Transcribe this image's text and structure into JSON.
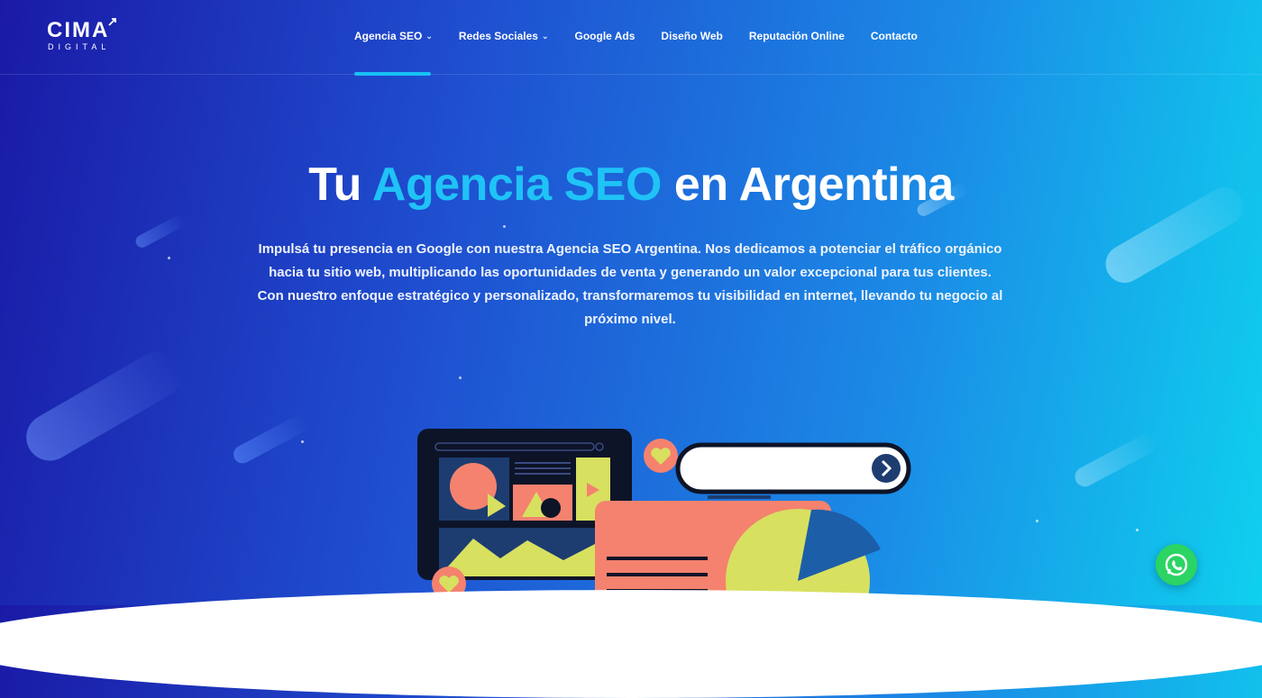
{
  "brand": {
    "logo_text": "CIMA",
    "logo_subtext": "DIGITAL"
  },
  "nav": {
    "items": [
      {
        "label": "Agencia SEO",
        "has_dropdown": true,
        "active": true
      },
      {
        "label": "Redes Sociales",
        "has_dropdown": true,
        "active": false
      },
      {
        "label": "Google Ads",
        "has_dropdown": false,
        "active": false
      },
      {
        "label": "Diseño Web",
        "has_dropdown": false,
        "active": false
      },
      {
        "label": "Reputación Online",
        "has_dropdown": false,
        "active": false
      },
      {
        "label": "Contacto",
        "has_dropdown": false,
        "active": false
      }
    ],
    "dropdown_icon": "chevron-down-icon"
  },
  "hero": {
    "title_part1": "Tu",
    "title_highlight": "Agencia SEO",
    "title_part2": "en Argentina",
    "description": "Impulsá tu presencia en Google con nuestra Agencia SEO Argentina. Nos dedicamos a potenciar el tráfico orgánico hacia tu sitio web, multiplicando las oportunidades de venta y generando un valor excepcional para tus clientes. Con nuestro enfoque estratégico y personalizado, transformaremos tu visibilidad en internet, llevando tu negocio al próximo nivel."
  },
  "floating": {
    "whatsapp_icon": "whatsapp-icon"
  },
  "colors": {
    "accent": "#1fc3f6",
    "whatsapp": "#2bd463",
    "illustration_salmon": "#f4826e",
    "illustration_yellow": "#d8e060",
    "illustration_navy": "#1d3d70"
  }
}
